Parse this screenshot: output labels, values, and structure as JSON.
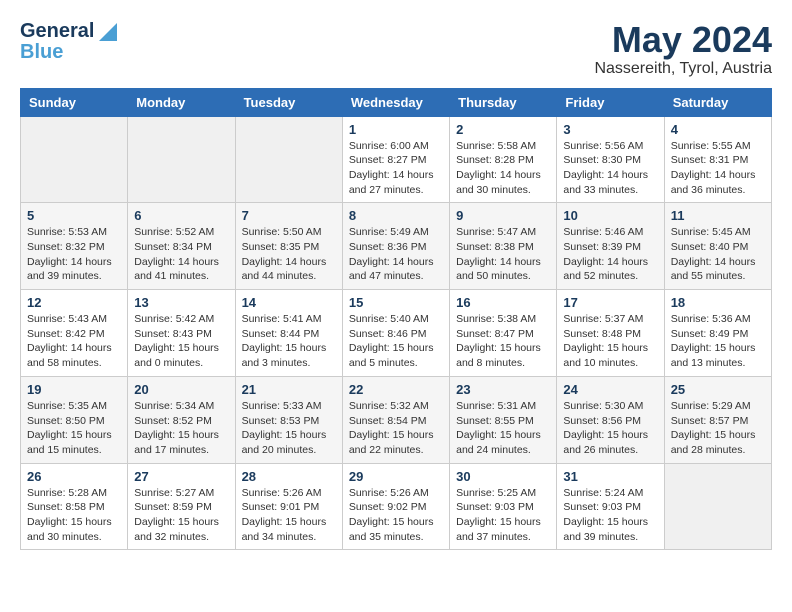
{
  "header": {
    "logo_general": "General",
    "logo_blue": "Blue",
    "month_title": "May 2024",
    "location": "Nassereith, Tyrol, Austria"
  },
  "calendar": {
    "days_of_week": [
      "Sunday",
      "Monday",
      "Tuesday",
      "Wednesday",
      "Thursday",
      "Friday",
      "Saturday"
    ],
    "weeks": [
      [
        {
          "day": "",
          "info": ""
        },
        {
          "day": "",
          "info": ""
        },
        {
          "day": "",
          "info": ""
        },
        {
          "day": "1",
          "info": "Sunrise: 6:00 AM\nSunset: 8:27 PM\nDaylight: 14 hours\nand 27 minutes."
        },
        {
          "day": "2",
          "info": "Sunrise: 5:58 AM\nSunset: 8:28 PM\nDaylight: 14 hours\nand 30 minutes."
        },
        {
          "day": "3",
          "info": "Sunrise: 5:56 AM\nSunset: 8:30 PM\nDaylight: 14 hours\nand 33 minutes."
        },
        {
          "day": "4",
          "info": "Sunrise: 5:55 AM\nSunset: 8:31 PM\nDaylight: 14 hours\nand 36 minutes."
        }
      ],
      [
        {
          "day": "5",
          "info": "Sunrise: 5:53 AM\nSunset: 8:32 PM\nDaylight: 14 hours\nand 39 minutes."
        },
        {
          "day": "6",
          "info": "Sunrise: 5:52 AM\nSunset: 8:34 PM\nDaylight: 14 hours\nand 41 minutes."
        },
        {
          "day": "7",
          "info": "Sunrise: 5:50 AM\nSunset: 8:35 PM\nDaylight: 14 hours\nand 44 minutes."
        },
        {
          "day": "8",
          "info": "Sunrise: 5:49 AM\nSunset: 8:36 PM\nDaylight: 14 hours\nand 47 minutes."
        },
        {
          "day": "9",
          "info": "Sunrise: 5:47 AM\nSunset: 8:38 PM\nDaylight: 14 hours\nand 50 minutes."
        },
        {
          "day": "10",
          "info": "Sunrise: 5:46 AM\nSunset: 8:39 PM\nDaylight: 14 hours\nand 52 minutes."
        },
        {
          "day": "11",
          "info": "Sunrise: 5:45 AM\nSunset: 8:40 PM\nDaylight: 14 hours\nand 55 minutes."
        }
      ],
      [
        {
          "day": "12",
          "info": "Sunrise: 5:43 AM\nSunset: 8:42 PM\nDaylight: 14 hours\nand 58 minutes."
        },
        {
          "day": "13",
          "info": "Sunrise: 5:42 AM\nSunset: 8:43 PM\nDaylight: 15 hours\nand 0 minutes."
        },
        {
          "day": "14",
          "info": "Sunrise: 5:41 AM\nSunset: 8:44 PM\nDaylight: 15 hours\nand 3 minutes."
        },
        {
          "day": "15",
          "info": "Sunrise: 5:40 AM\nSunset: 8:46 PM\nDaylight: 15 hours\nand 5 minutes."
        },
        {
          "day": "16",
          "info": "Sunrise: 5:38 AM\nSunset: 8:47 PM\nDaylight: 15 hours\nand 8 minutes."
        },
        {
          "day": "17",
          "info": "Sunrise: 5:37 AM\nSunset: 8:48 PM\nDaylight: 15 hours\nand 10 minutes."
        },
        {
          "day": "18",
          "info": "Sunrise: 5:36 AM\nSunset: 8:49 PM\nDaylight: 15 hours\nand 13 minutes."
        }
      ],
      [
        {
          "day": "19",
          "info": "Sunrise: 5:35 AM\nSunset: 8:50 PM\nDaylight: 15 hours\nand 15 minutes."
        },
        {
          "day": "20",
          "info": "Sunrise: 5:34 AM\nSunset: 8:52 PM\nDaylight: 15 hours\nand 17 minutes."
        },
        {
          "day": "21",
          "info": "Sunrise: 5:33 AM\nSunset: 8:53 PM\nDaylight: 15 hours\nand 20 minutes."
        },
        {
          "day": "22",
          "info": "Sunrise: 5:32 AM\nSunset: 8:54 PM\nDaylight: 15 hours\nand 22 minutes."
        },
        {
          "day": "23",
          "info": "Sunrise: 5:31 AM\nSunset: 8:55 PM\nDaylight: 15 hours\nand 24 minutes."
        },
        {
          "day": "24",
          "info": "Sunrise: 5:30 AM\nSunset: 8:56 PM\nDaylight: 15 hours\nand 26 minutes."
        },
        {
          "day": "25",
          "info": "Sunrise: 5:29 AM\nSunset: 8:57 PM\nDaylight: 15 hours\nand 28 minutes."
        }
      ],
      [
        {
          "day": "26",
          "info": "Sunrise: 5:28 AM\nSunset: 8:58 PM\nDaylight: 15 hours\nand 30 minutes."
        },
        {
          "day": "27",
          "info": "Sunrise: 5:27 AM\nSunset: 8:59 PM\nDaylight: 15 hours\nand 32 minutes."
        },
        {
          "day": "28",
          "info": "Sunrise: 5:26 AM\nSunset: 9:01 PM\nDaylight: 15 hours\nand 34 minutes."
        },
        {
          "day": "29",
          "info": "Sunrise: 5:26 AM\nSunset: 9:02 PM\nDaylight: 15 hours\nand 35 minutes."
        },
        {
          "day": "30",
          "info": "Sunrise: 5:25 AM\nSunset: 9:03 PM\nDaylight: 15 hours\nand 37 minutes."
        },
        {
          "day": "31",
          "info": "Sunrise: 5:24 AM\nSunset: 9:03 PM\nDaylight: 15 hours\nand 39 minutes."
        },
        {
          "day": "",
          "info": ""
        }
      ]
    ]
  }
}
